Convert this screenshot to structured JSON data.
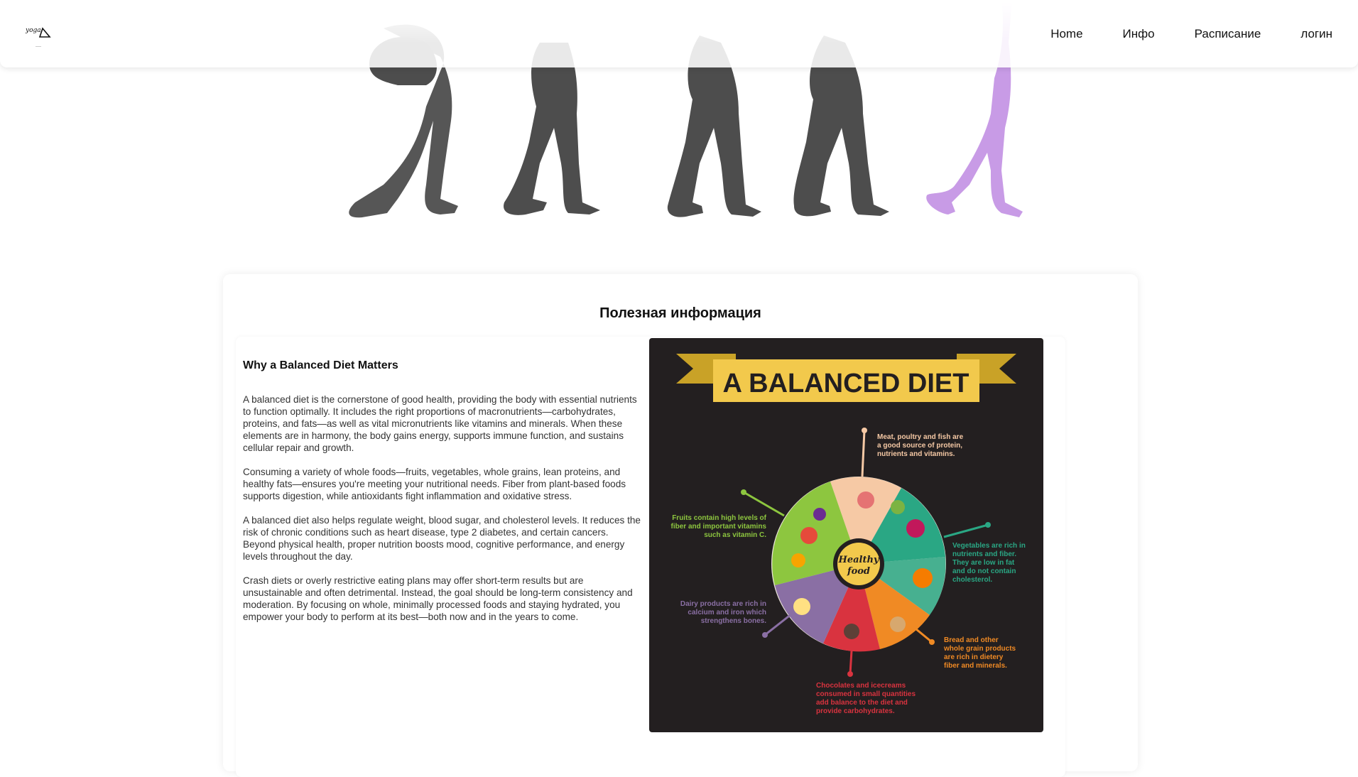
{
  "header": {
    "logo_text": "yoga",
    "nav": [
      "Home",
      "Инфо",
      "Расписание",
      "логин"
    ]
  },
  "colors": {
    "silhouette_gray": "#4d4d4d",
    "silhouette_purple": "#c89be6",
    "infographic_bg": "#231f20",
    "banner_yellow": "#f2c94c"
  },
  "main": {
    "section_title": "Полезная информация",
    "article": {
      "title": "Why a Balanced Diet Matters",
      "paragraphs": [
        "A balanced diet is the cornerstone of good health, providing the body with essential nutrients to function optimally. It includes the right proportions of macronutrients—carbohydrates, proteins, and fats—as well as vital micronutrients like vitamins and minerals. When these elements are in harmony, the body gains energy, supports immune function, and sustains cellular repair and growth.",
        "Consuming a variety of whole foods—fruits, vegetables, whole grains, lean proteins, and healthy fats—ensures you're meeting your nutritional needs. Fiber from plant-based foods supports digestion, while antioxidants fight inflammation and oxidative stress.",
        "A balanced diet also helps regulate weight, blood sugar, and cholesterol levels. It reduces the risk of chronic conditions such as heart disease, type 2 diabetes, and certain cancers. Beyond physical health, proper nutrition boosts mood, cognitive performance, and energy levels throughout the day.",
        "Crash diets or overly restrictive eating plans may offer short-term results but are unsustainable and often detrimental. Instead, the goal should be long-term consistency and moderation. By focusing on whole, minimally processed foods and staying hydrated, you empower your body to perform at its best—both now and in the years to come."
      ]
    },
    "infographic": {
      "title": "A BALANCED DIET",
      "center_line1": "Healthy",
      "center_line2": "food",
      "labels": {
        "meat": [
          "Meat, poultry and fish are",
          "a good source of protein,",
          "nutrients and vitamins."
        ],
        "fruits": [
          "Fruits contain high levels of",
          "fiber and important vitamins",
          "such as vitamin C."
        ],
        "vegetables": [
          "Vegetables are rich in",
          "nutrients and fiber.",
          "They are low in fat",
          "and do not contain",
          "cholesterol."
        ],
        "dairy": [
          "Dairy products are rich in",
          "calcium and iron which",
          "strengthens bones."
        ],
        "bread": [
          "Bread and other",
          "whole grain products",
          "are rich in dietery",
          "fiber and minerals."
        ],
        "sweets": [
          "Chocolates and icecreams",
          "consumed in small quantities",
          "add balance to the diet and",
          "provide carbohydrates."
        ]
      }
    }
  }
}
